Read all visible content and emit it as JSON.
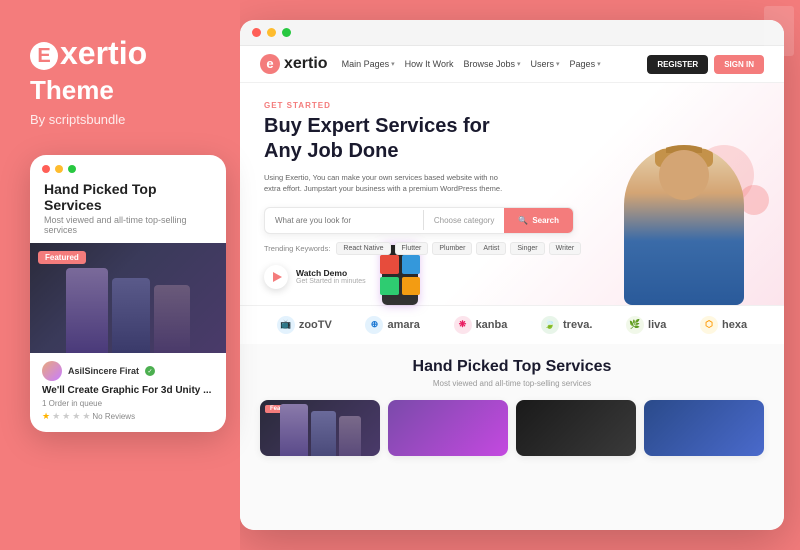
{
  "brand": {
    "name_prefix": "E",
    "name": "xertio",
    "subtitle": "Theme",
    "by": "By scriptsbundle"
  },
  "mobile_card": {
    "heading": "Hand Picked Top Services",
    "subheading": "Most viewed and all-time top-selling services",
    "featured_badge": "Featured",
    "user": {
      "name": "AsilSincere Firat",
      "verified": true
    },
    "card_title": "We'll Create Graphic For 3d Unity ...",
    "orders": "1 Order in queue",
    "reviews": "No Reviews"
  },
  "browser": {
    "nav": {
      "logo": "xertio",
      "logo_prefix": "e",
      "links": [
        {
          "label": "Main Pages",
          "has_arrow": true
        },
        {
          "label": "How It Work",
          "has_arrow": false
        },
        {
          "label": "Browse Jobs",
          "has_arrow": true
        },
        {
          "label": "Users",
          "has_arrow": true
        },
        {
          "label": "Pages",
          "has_arrow": true
        }
      ],
      "btn_register": "REGISTER",
      "btn_signin": "SIGN IN"
    },
    "hero": {
      "tag": "GET STARTED",
      "title": "Buy Expert Services for Any Job Done",
      "description": "Using Exertio, You can make your own services based website with no extra effort. Jumpstart your business with a premium WordPress theme.",
      "search_placeholder": "What are you look for",
      "category_placeholder": "Choose category",
      "search_btn": "Search",
      "trending_label": "Trending Keywords:",
      "trending_tags": [
        "React Native",
        "Flutter",
        "Plumber",
        "Artist",
        "Singer",
        "Writer"
      ],
      "watch_label": "Watch Demo",
      "watch_sub": "Get Started in minutes"
    },
    "partners": [
      {
        "name": "zootv",
        "icon": "📺",
        "color": "#2196f3"
      },
      {
        "name": "amara",
        "icon": "🔵",
        "color": "#1976d2"
      },
      {
        "name": "kanba",
        "icon": "💠",
        "color": "#e91e63"
      },
      {
        "name": "treva.",
        "icon": "🍀",
        "color": "#4caf50"
      },
      {
        "name": "liva",
        "icon": "🌿",
        "color": "#8bc34a"
      },
      {
        "name": "hexa",
        "icon": "🔶",
        "color": "#ff9800"
      }
    ],
    "services": {
      "title": "Hand Picked Top Services",
      "subtitle": "Most viewed and all-time top-selling services",
      "cards": [
        {
          "featured": true,
          "bg": "service-img-1"
        },
        {
          "featured": false,
          "bg": "service-img-2"
        },
        {
          "featured": false,
          "bg": "service-img-3"
        },
        {
          "featured": false,
          "bg": "service-img-4"
        }
      ]
    }
  }
}
